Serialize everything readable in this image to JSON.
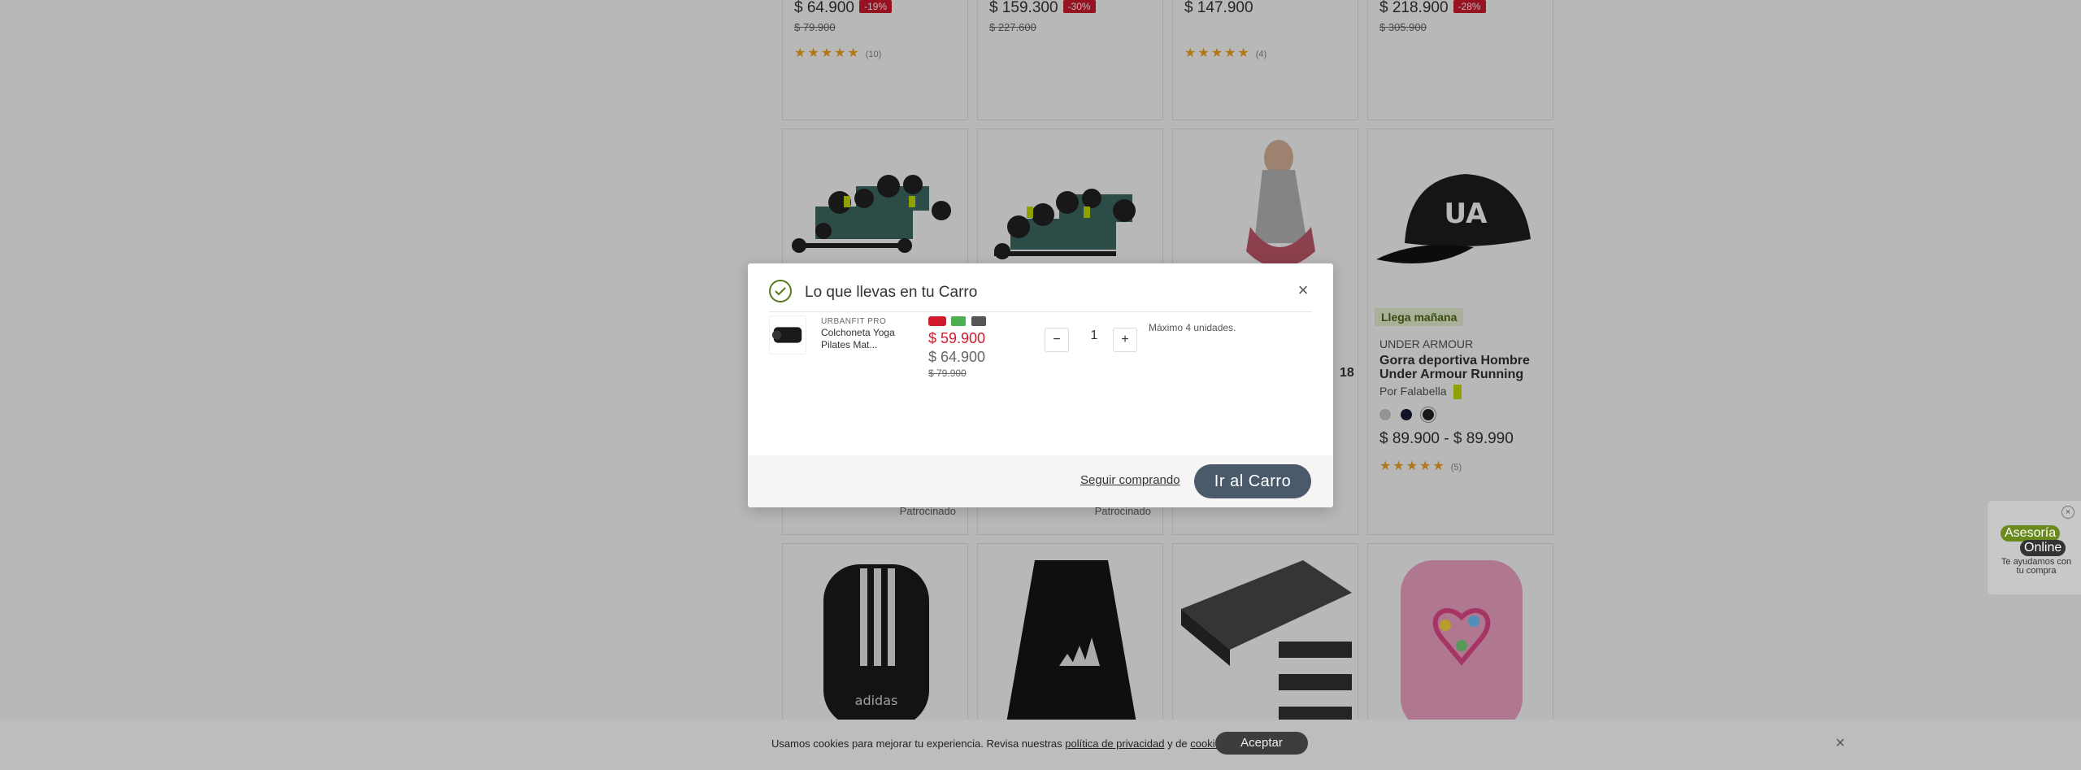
{
  "background": {
    "row1": [
      {
        "price": "$ 64.900",
        "discount": "-19%",
        "old_price": "$ 79.900",
        "rating_count": "(10)"
      },
      {
        "price": "$ 159.300",
        "discount": "-30%",
        "old_price": "$ 227.600",
        "rating_count": ""
      },
      {
        "price": "$ 147.900",
        "discount": "",
        "old_price": "",
        "rating_count": "(4)"
      },
      {
        "price": "$ 218.900",
        "discount": "-28%",
        "old_price": "$ 305.900",
        "rating_count": ""
      }
    ],
    "row2": [
      {
        "sponsored": "Patrocinado"
      },
      {
        "sponsored": "Patrocinado"
      },
      {
        "partial_text": "18"
      },
      {
        "badge": "Llega mañana",
        "brand": "UNDER ARMOUR",
        "title": "Gorra deportiva Hombre Under Armour Running",
        "seller": "Por Falabella",
        "price_range": "$ 89.900 - $ 89.990",
        "rating_count": "(5)"
      }
    ],
    "row3_logo": "adidas"
  },
  "modal": {
    "title": "Lo que llevas en tu Carro",
    "close_label": "×",
    "product": {
      "brand": "URBANFIT PRO",
      "name": "Colchoneta Yoga Pilates Mat...",
      "price_cmr": "$ 59.900",
      "price_internet": "$ 64.900",
      "price_normal": "$ 79.900",
      "quantity": "1",
      "max_note": "Máximo 4 unidades."
    },
    "qty_minus": "−",
    "qty_plus": "+",
    "continue_label": "Seguir comprando",
    "cart_button": "Ir al Carro"
  },
  "cookie": {
    "text_before": "Usamos cookies para mejorar tu experiencia. Revisa nuestras",
    "privacy_link": "política de privacidad",
    "text_middle": "y de",
    "cookies_link": "cookies",
    "text_end": ".",
    "accept_label": "Aceptar",
    "close_label": "×"
  },
  "asesoria": {
    "tag1": "Asesoría",
    "tag2": "Online",
    "subtitle": "Te ayudamos con tu compra",
    "close_label": "×"
  },
  "colors": {
    "cmr_red": "#d21a2e",
    "button_dark": "#4a5a6a",
    "check_green": "#5a7a20",
    "badge_green_bg": "#eaf4d4"
  }
}
